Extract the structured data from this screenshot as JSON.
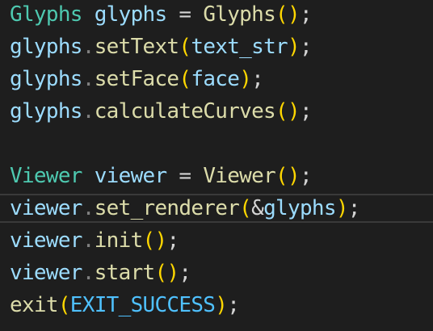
{
  "editor": {
    "theme": "dark",
    "background": "#1e1e1e",
    "highlighted_line": 7,
    "colors": {
      "type": "#4ec9b0",
      "variable": "#9cdcfe",
      "function": "#dcdcaa",
      "constant": "#4fc1ff",
      "bracket": "#ffd700",
      "punctuation": "#d4d4d4"
    },
    "lines": [
      {
        "type": "Glyphs",
        "var": "glyphs",
        "assign": " = ",
        "ctor": "Glyphs",
        "open": "(",
        "close": ")",
        "end": ";"
      },
      {
        "var": "glyphs",
        "dot": ".",
        "fn": "setText",
        "open": "(",
        "arg": "text_str",
        "close": ")",
        "end": ";"
      },
      {
        "var": "glyphs",
        "dot": ".",
        "fn": "setFace",
        "open": "(",
        "arg": "face",
        "close": ")",
        "end": ";"
      },
      {
        "var": "glyphs",
        "dot": ".",
        "fn": "calculateCurves",
        "open": "(",
        "close": ")",
        "end": ";"
      },
      {},
      {
        "type": "Viewer",
        "var": "viewer",
        "assign": " = ",
        "ctor": "Viewer",
        "open": "(",
        "close": ")",
        "end": ";"
      },
      {
        "var": "viewer",
        "dot": ".",
        "fn": "set_renderer",
        "open": "(",
        "amp": "&",
        "arg": "glyphs",
        "close": ")",
        "end": ";"
      },
      {
        "var": "viewer",
        "dot": ".",
        "fn": "init",
        "open": "(",
        "close": ")",
        "end": ";"
      },
      {
        "var": "viewer",
        "dot": ".",
        "fn": "start",
        "open": "(",
        "close": ")",
        "end": ";"
      },
      {
        "fn": "exit",
        "open": "(",
        "arg": "EXIT_SUCCESS",
        "close": ")",
        "end": ";"
      }
    ]
  }
}
